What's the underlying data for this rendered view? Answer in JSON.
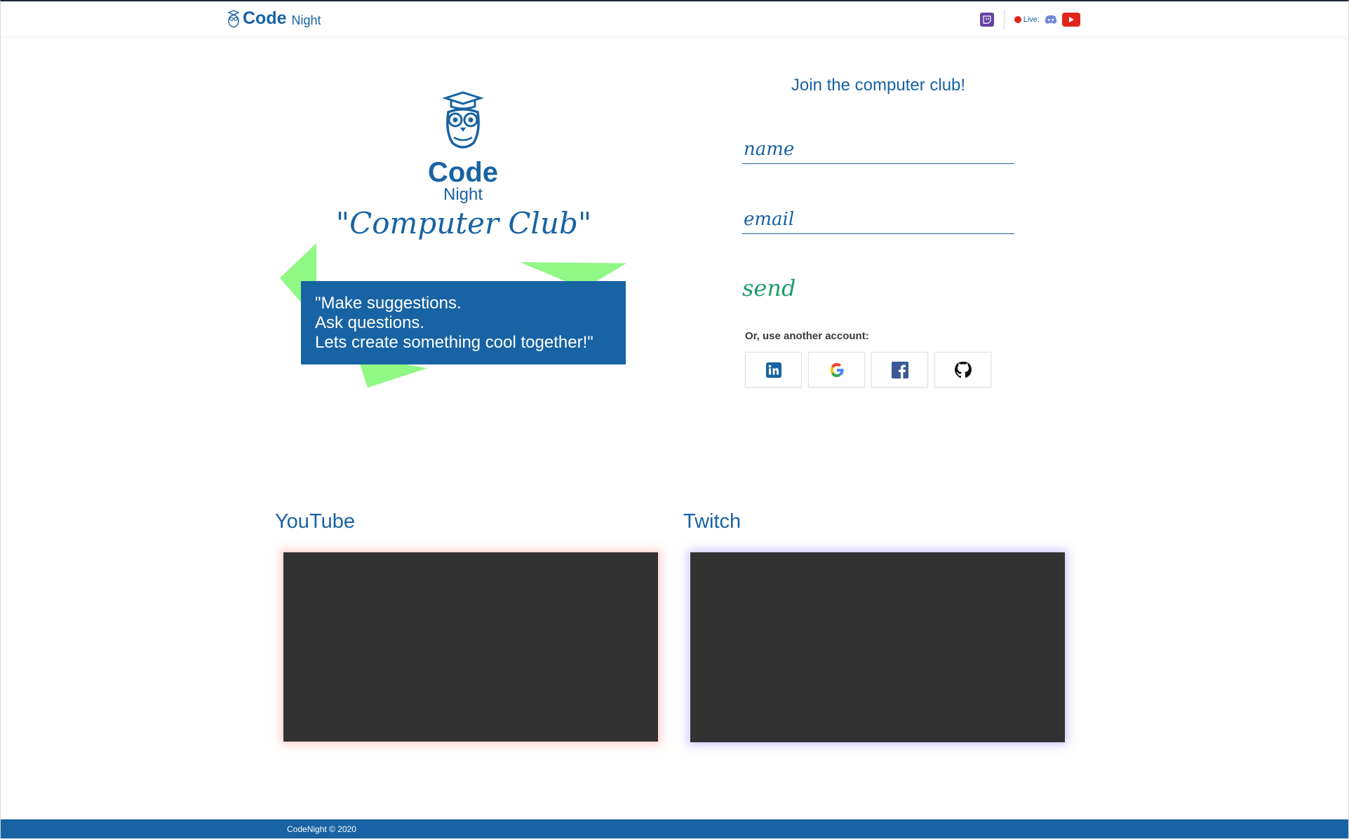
{
  "header": {
    "brand_code": "Code",
    "brand_night": "Night",
    "live_label": "Live:"
  },
  "hero": {
    "logo_code": "Code",
    "logo_night": "Night",
    "tagline": "\"Computer Club\"",
    "quote": "\"Make suggestions.\n Ask questions.\n Lets create something cool together!\""
  },
  "form": {
    "title": "Join the computer club!",
    "name_placeholder": "name",
    "email_placeholder": "email",
    "send_label": "send",
    "alt_label": "Or, use another account:",
    "providers": [
      "linkedin-icon",
      "google-icon",
      "facebook-icon",
      "github-icon"
    ]
  },
  "media": {
    "youtube_title": "YouTube",
    "twitch_title": "Twitch"
  },
  "footer": {
    "copyright": "CodeNight © 2020"
  },
  "colors": {
    "brand_blue": "#1863a3",
    "accent_green": "#90f884",
    "send_green": "#1f9d6d",
    "twitch_purple": "#6441a5",
    "youtube_red": "#e2241c",
    "player_bg": "#323232"
  }
}
